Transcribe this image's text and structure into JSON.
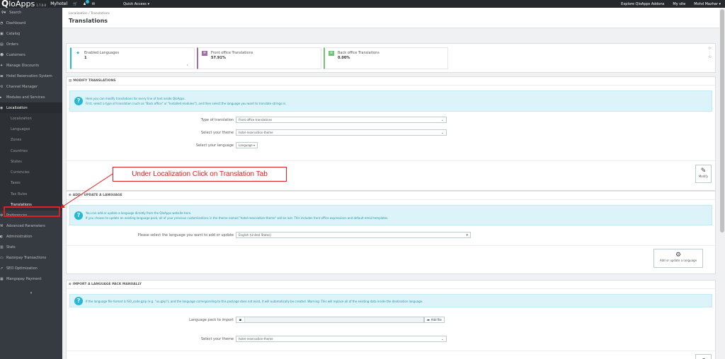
{
  "topbar": {
    "logo_mark": "Q",
    "logo_text": "loApps",
    "version": "1.7.0.0",
    "site": "Myhotel",
    "quick_access": "Quick Access ▾",
    "explore": "Explore QloApps Addons",
    "my_site": "My site",
    "user": "Mohd Mazhar ▾"
  },
  "sidebar": {
    "search_placeholder": "Search",
    "items": [
      {
        "label": "Dashboard",
        "icon": "dashboard-icon",
        "glyph": "◔"
      },
      {
        "label": "Catalog",
        "icon": "catalog-icon",
        "glyph": "▣"
      },
      {
        "label": "Orders",
        "icon": "orders-icon",
        "glyph": "▤"
      },
      {
        "label": "Customers",
        "icon": "customers-icon",
        "glyph": "☻"
      },
      {
        "label": "Manage Discounts",
        "icon": "discount-icon",
        "glyph": "✦"
      },
      {
        "label": "Hotel Reservation System",
        "icon": "hotel-icon",
        "glyph": "▬"
      },
      {
        "label": "Channel Manager",
        "icon": "channel-icon",
        "glyph": "⟲"
      },
      {
        "label": "Modules and Services",
        "icon": "modules-icon",
        "glyph": "▸"
      },
      {
        "label": "Localization",
        "icon": "globe-icon",
        "glyph": "◉"
      }
    ],
    "sub_items": [
      "Localization",
      "Languages",
      "Zones",
      "Countries",
      "States",
      "Currencies",
      "Taxes",
      "Tax Rules",
      "Translations"
    ],
    "items_after": [
      {
        "label": "Preferences",
        "icon": "preferences-icon",
        "glyph": "⚙"
      },
      {
        "label": "Advanced Parameters",
        "icon": "advanced-icon",
        "glyph": "⚒"
      },
      {
        "label": "Administration",
        "icon": "admin-icon",
        "glyph": "◐"
      },
      {
        "label": "Stats",
        "icon": "stats-icon",
        "glyph": "▥"
      },
      {
        "label": "Razorpay Transactions",
        "icon": "razorpay-icon",
        "glyph": "▭"
      },
      {
        "label": "SEO Optimization",
        "icon": "seo-icon",
        "glyph": "↗"
      },
      {
        "label": "Mangopay Payment",
        "icon": "mangopay-icon",
        "glyph": "▦"
      }
    ],
    "bottom_icon": "collapse-icon"
  },
  "header": {
    "breadcrumb": "Localization  /  Translations",
    "title": "Translations"
  },
  "kpis": [
    {
      "title": "Enabled Languages",
      "value": "1",
      "color": "#25b9d7"
    },
    {
      "title": "Front office Translations",
      "value": "57.91%",
      "color": "#a06fa8"
    },
    {
      "title": "Back office Translations",
      "value": "0.00%",
      "color": "#72c279"
    }
  ],
  "modify": {
    "heading": "MODIFY TRANSLATIONS",
    "alert_line1": "Here you can modify translations for every line of text inside QloApps.",
    "alert_line2": "First, select a type of translation (such as \"Back office\" or \"Installed modules\"), and then select the language you want to translate strings in.",
    "type_label": "Type of translation",
    "type_value": "Front office translations",
    "theme_label": "Select your theme",
    "theme_value": "hotel-reservation-theme",
    "language_label": "Select your language",
    "language_value": "Language ▾",
    "button": "Modify"
  },
  "add_update": {
    "heading": "ADD / UPDATE A LANGUAGE",
    "alert_line1": "You can add or update a language directly from the QloApps website here.",
    "alert_line2": "If you choose to update an existing language pack, all of your previous customizations in the theme named \"hotel-reservation-theme\" will be lost. This includes front office expressions and default email templates.",
    "label": "Please select the language you want to add or update",
    "value": "English (United States)",
    "button": "Add or update a language"
  },
  "import": {
    "heading": "IMPORT A LANGUAGE PACK MANUALLY",
    "alert": "If the language file format is ISO_code.gzip (e.g. \"us.gzip\"), and the language corresponding to this package does not exist, it will automatically be created. Warning: This will replace all of the existing data inside the destination language.",
    "pack_label": "Language pack to import",
    "add_file": "Add file",
    "theme_label": "Select your theme",
    "theme_value": "hotel-reservation-theme"
  },
  "annotation": {
    "text": "Under Localization Click on Translation Tab",
    "color": "#e02020"
  }
}
